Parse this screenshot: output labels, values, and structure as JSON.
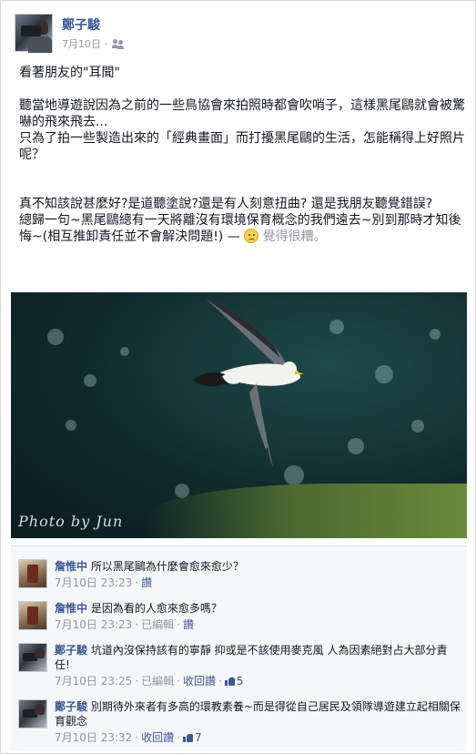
{
  "post": {
    "author": "鄭子駿",
    "date": "7月10日",
    "privacy_icon": "friends-icon",
    "paragraphs": [
      "看著朋友的\"耳聞\"",
      "聽當地導遊說因為之前的一些鳥協會來拍照時都會吹哨子，這樣黑尾鷗就會被驚嚇的飛來飛去...",
      "只為了拍一些製造出來的「經典畫面」而打擾黑尾鷗的生活，怎能稱得上好照片呢？",
      "真不知該說甚麼好?是道聽塗說?還是有人刻意扭曲? 還是我朋友聽覺錯誤?",
      "總歸一句~黑尾鷗總有一天將離沒有環境保育概念的我們遠去~別到那時才知後悔~(相互推卸責任並不會解決問題!) — ",
      "覺得很糟。"
    ],
    "feeling_icon": "sad-face-icon"
  },
  "photo": {
    "watermark": "Photo by Jun"
  },
  "comments": [
    {
      "name": "詹惟中",
      "text": "所以黑尾鷗為什麼會愈來愈少？",
      "time": "7月10日 23:23",
      "edited": "",
      "like_label": "讚",
      "reply_label": "",
      "likes": ""
    },
    {
      "name": "詹惟中",
      "text": "是因為看的人愈來愈多嗎？",
      "time": "7月10日 23:23",
      "edited": "已編輯",
      "like_label": "讚",
      "reply_label": "",
      "likes": ""
    },
    {
      "name": "鄭子駿",
      "text": "坑道內沒保持該有的寧靜 抑或是不該使用麥克風 人為因素絕對占大部分責任!",
      "time": "7月10日 23:25",
      "edited": "已編輯",
      "like_label": "",
      "reply_label": "收回讚",
      "likes": "5"
    },
    {
      "name": "鄭子駿",
      "text": "別期待外來者有多高的環教素養~而是得從自己居民及領隊導遊建立起相關保育觀念",
      "time": "7月10日 23:32",
      "edited": "",
      "like_label": "",
      "reply_label": "收回讚",
      "likes": "7"
    }
  ],
  "colors": {
    "link": "#3b5998",
    "meta": "#9197a3",
    "comment_bg": "#f6f7f8"
  }
}
